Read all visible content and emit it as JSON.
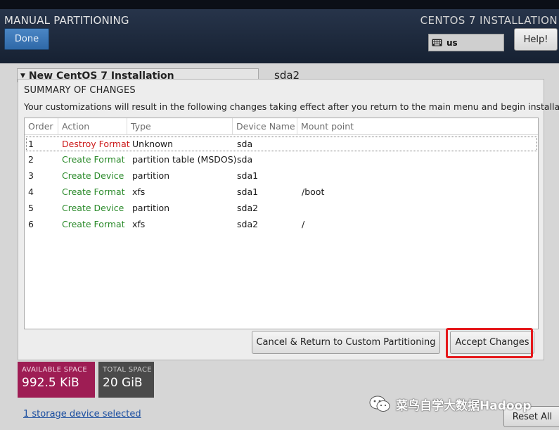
{
  "header": {
    "title": "MANUAL PARTITIONING",
    "installer_title": "CENTOS 7 INSTALLATION",
    "done_label": "Done",
    "keyboard_layout": "us",
    "help_label": "Help!"
  },
  "background": {
    "left_section_title": "New CentOS 7 Installation",
    "right_title": "sda2",
    "available_space_label": "AVAILABLE SPACE",
    "available_space_value": "992.5 KiB",
    "total_space_label": "TOTAL SPACE",
    "total_space_value": "20 GiB",
    "storage_link": "1 storage device selected",
    "reset_label": "Reset All",
    "watermark_text": "菜鸟自学大数据Hadoop"
  },
  "dialog": {
    "title": "SUMMARY OF CHANGES",
    "description": "Your customizations will result in the following changes taking effect after you return to the main menu and begin installation:",
    "columns": [
      "Order",
      "Action",
      "Type",
      "Device Name",
      "Mount point"
    ],
    "rows": [
      {
        "order": "1",
        "action": "Destroy Format",
        "type": "Unknown",
        "device": "sda",
        "mount": ""
      },
      {
        "order": "2",
        "action": "Create Format",
        "type": "partition table (MSDOS)",
        "device": "sda",
        "mount": ""
      },
      {
        "order": "3",
        "action": "Create Device",
        "type": "partition",
        "device": "sda1",
        "mount": ""
      },
      {
        "order": "4",
        "action": "Create Format",
        "type": "xfs",
        "device": "sda1",
        "mount": "/boot"
      },
      {
        "order": "5",
        "action": "Create Device",
        "type": "partition",
        "device": "sda2",
        "mount": ""
      },
      {
        "order": "6",
        "action": "Create Format",
        "type": "xfs",
        "device": "sda2",
        "mount": "/"
      }
    ],
    "cancel_label": "Cancel & Return to Custom Partitioning",
    "accept_label": "Accept Changes"
  },
  "colors": {
    "destroy_action": "#cc1a1a",
    "create_action": "#2a8a2a",
    "highlight": "#e5191c",
    "available_space_bg": "#9e1d54"
  }
}
